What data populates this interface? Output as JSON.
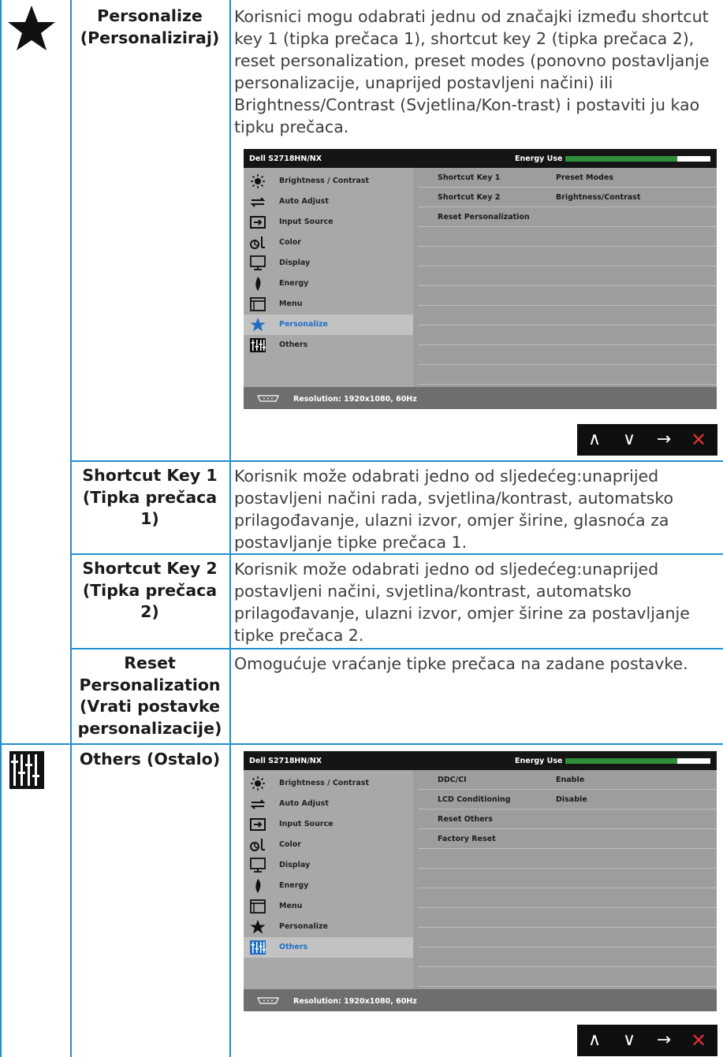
{
  "rows": [
    {
      "label_line1": "Personalize",
      "label_line2": "(Personaliziraj)",
      "description": "Korisnici mogu odabrati jednu od značajki između shortcut key 1 (tipka prečaca 1), shortcut key 2 (tipka prečaca 2), reset personalization, preset modes (ponovno postavljanje personalizacije, unaprijed postavljeni načini) ili Brightness/Contrast (Svjetlina/Kon-trast) i postaviti ju kao tipku prečaca."
    },
    {
      "label_line1": "Shortcut Key 1",
      "label_line2": "(Tipka prečaca 1)",
      "description": "Korisnik može odabrati jedno od sljedećeg:unaprijed postavljeni načini rada, svjetlina/kontrast, automatsko prilagođavanje, ulazni izvor, omjer širine, glasnoća za postavljanje tipke prečaca 1."
    },
    {
      "label_line1": "Shortcut Key 2",
      "label_line2": "(Tipka prečaca 2)",
      "description": "Korisnik može odabrati jedno od sljedećeg:unaprijed postavljeni načini, svjetlina/kontrast, automatsko prilagođavanje, ulazni izvor, omjer širine za postavljanje tipke prečaca 2."
    },
    {
      "label_line1": "Reset",
      "label_line2": "Personalization",
      "label_line3": "(Vrati postavke",
      "label_line4": "personalizacije)",
      "description": "Omogućuje vraćanje tipke prečaca na zadane postavke."
    },
    {
      "label_line1": "Others (Ostalo)"
    }
  ],
  "osd": {
    "model": "Dell S2718HN/NX",
    "energy_label": "Energy Use",
    "energy_level": 0.77,
    "energy_color": "#2f8f3d",
    "resolution": "Resolution: 1920x1080, 60Hz",
    "menu": [
      {
        "label": "Brightness / Contrast",
        "icon": "brightness-icon"
      },
      {
        "label": "Auto Adjust",
        "icon": "auto-adjust-icon"
      },
      {
        "label": "Input Source",
        "icon": "input-source-icon"
      },
      {
        "label": "Color",
        "icon": "color-icon"
      },
      {
        "label": "Display",
        "icon": "display-icon"
      },
      {
        "label": "Energy",
        "icon": "energy-icon"
      },
      {
        "label": "Menu",
        "icon": "menu-icon"
      },
      {
        "label": "Personalize",
        "icon": "star-icon"
      },
      {
        "label": "Others",
        "icon": "sliders-icon"
      }
    ]
  },
  "osd1": {
    "selected": "Personalize",
    "options": [
      {
        "key": "Shortcut Key 1",
        "value": "Preset Modes"
      },
      {
        "key": "Shortcut Key 2",
        "value": "Brightness/Contrast"
      },
      {
        "key": "Reset Personalization",
        "value": ""
      }
    ]
  },
  "osd2": {
    "selected": "Others",
    "options": [
      {
        "key": "DDC/CI",
        "value": "Enable"
      },
      {
        "key": "LCD Conditioning",
        "value": "Disable"
      },
      {
        "key": "Reset Others",
        "value": ""
      },
      {
        "key": "Factory Reset",
        "value": ""
      }
    ]
  },
  "nav": {
    "up": "∧",
    "down": "∨",
    "right": "→",
    "close": "✕"
  },
  "colors": {
    "rule": "#1f8fd0",
    "selected_text": "#1f6fc2",
    "close": "#e0302e"
  }
}
